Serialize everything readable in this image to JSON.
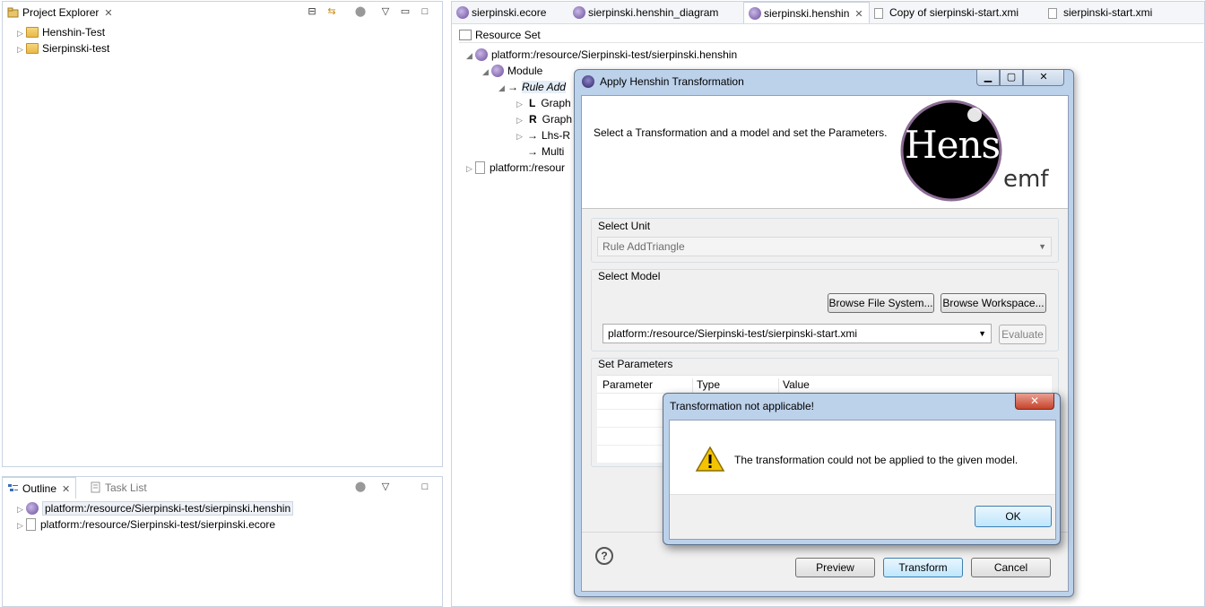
{
  "project_explorer": {
    "tab_label": "Project Explorer",
    "items": [
      {
        "label": "Henshin-Test"
      },
      {
        "label": "Sierpinski-test"
      }
    ]
  },
  "outline": {
    "tab_outline": "Outline",
    "tab_tasklist": "Task List",
    "items": [
      {
        "label": "platform:/resource/Sierpinski-test/sierpinski.henshin"
      },
      {
        "label": "platform:/resource/Sierpinski-test/sierpinski.ecore"
      }
    ]
  },
  "editor": {
    "tabs": [
      {
        "label": "sierpinski.ecore"
      },
      {
        "label": "sierpinski.henshin_diagram"
      },
      {
        "label": "sierpinski.henshin"
      },
      {
        "label": "Copy of sierpinski-start.xmi"
      },
      {
        "label": "sierpinski-start.xmi"
      }
    ],
    "resource_set_label": "Resource Set",
    "tree": [
      {
        "label": "platform:/resource/Sierpinski-test/sierpinski.henshin"
      },
      {
        "label": "Module"
      },
      {
        "label": "Rule Add"
      },
      {
        "label": "Graph"
      },
      {
        "label": "Graph"
      },
      {
        "label": "Lhs-R"
      },
      {
        "label": "Multi"
      },
      {
        "label": "platform:/resour"
      }
    ]
  },
  "dialog": {
    "title": "Apply Henshin Transformation",
    "description": "Select a Transformation and a model and set the Parameters.",
    "logo_text": "Henshin",
    "logo_sub": "emf",
    "select_unit_label": "Select Unit",
    "select_unit_value": "Rule AddTriangle",
    "select_model_label": "Select Model",
    "browse_fs": "Browse File System...",
    "browse_ws": "Browse Workspace...",
    "model_value": "platform:/resource/Sierpinski-test/sierpinski-start.xmi",
    "evaluate": "Evaluate",
    "params_label": "Set Parameters",
    "param_headers": [
      "Parameter",
      "Type",
      "Value"
    ],
    "help": "?",
    "preview": "Preview",
    "transform": "Transform",
    "cancel": "Cancel"
  },
  "message": {
    "title": "Transformation not applicable!",
    "text": "The transformation could not be applied to the given model.",
    "ok": "OK"
  }
}
